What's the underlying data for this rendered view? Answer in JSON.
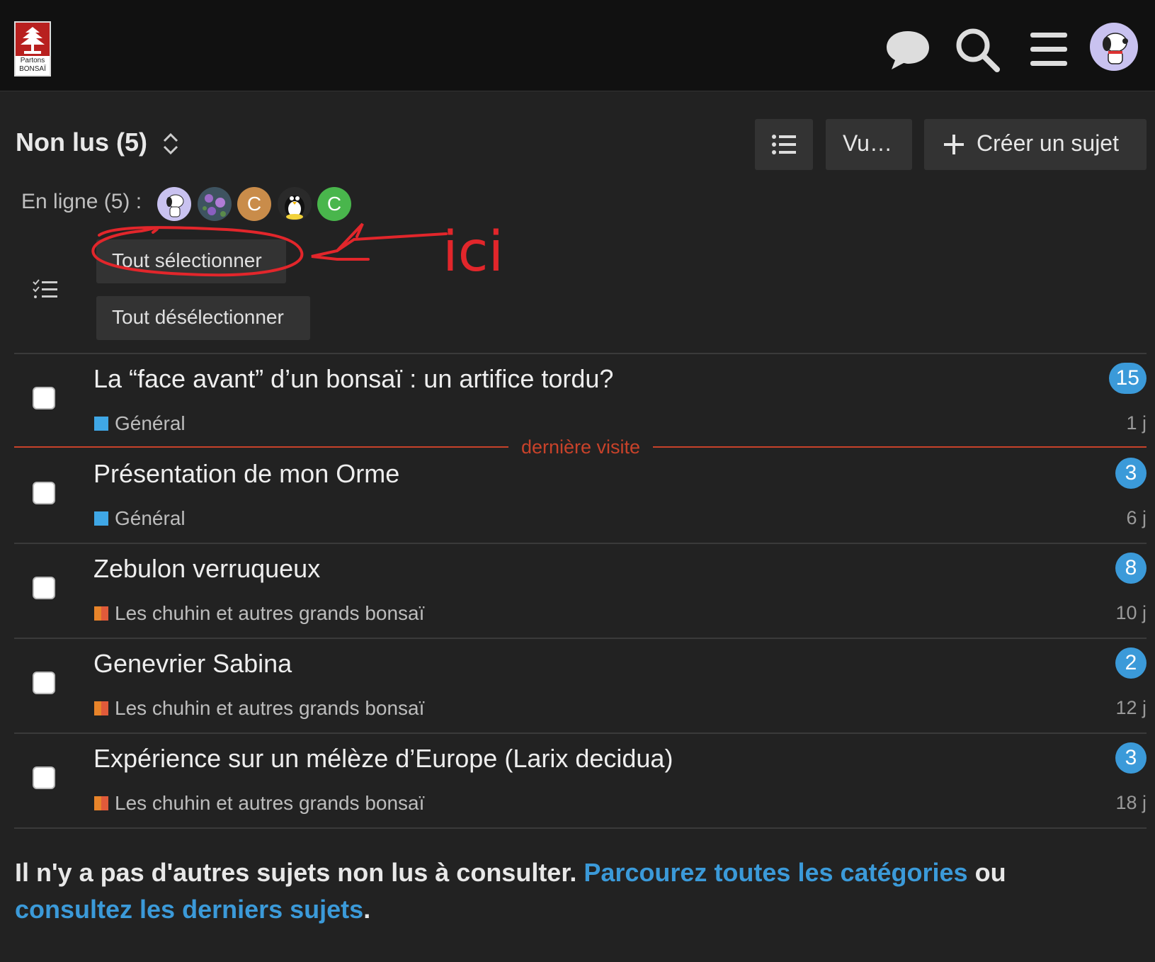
{
  "header": {
    "logo_text_line1": "Partons",
    "logo_text_line2": "BONSAÏ",
    "icons": [
      "chat-icon",
      "search-icon",
      "hamburger-menu-icon",
      "user-avatar"
    ]
  },
  "page": {
    "title": "Non lus (5)",
    "list_button_icon": "list-icon",
    "views_button_label": "Vu…",
    "create_button_label": "Créer un sujet"
  },
  "online": {
    "label": "En ligne (5) :",
    "users": [
      {
        "initial": "",
        "type": "snoopy-avatar"
      },
      {
        "initial": "",
        "type": "flowers-avatar"
      },
      {
        "initial": "C",
        "color": "#c98c4a"
      },
      {
        "initial": "",
        "type": "penguin-avatar"
      },
      {
        "initial": "C",
        "color": "#49b64c"
      }
    ]
  },
  "bulk": {
    "select_all_label": "Tout sélectionner",
    "deselect_all_label": "Tout désélectionner",
    "annotation_text": "ici"
  },
  "last_visit_label": "dernière visite",
  "topics": [
    {
      "title": "La “face avant” d’un bonsaï : un artifice tordu?",
      "category": "Général",
      "category_color": "#3fa7e6",
      "unread": "15",
      "age": "1 j"
    },
    {
      "title": "Présentation de mon Orme",
      "category": "Général",
      "category_color": "#3fa7e6",
      "unread": "3",
      "age": "6 j"
    },
    {
      "title": "Zebulon verruqueux",
      "category": "Les chuhin et autres grands bonsaï",
      "category_color": "#e8842a",
      "unread": "8",
      "age": "10 j"
    },
    {
      "title": "Genevrier Sabina",
      "category": "Les chuhin et autres grands bonsaï",
      "category_color": "#e8842a",
      "unread": "2",
      "age": "12 j"
    },
    {
      "title": "Expérience sur un mélèze d’Europe (Larix decidua)",
      "category": "Les chuhin et autres grands bonsaï",
      "category_color": "#e8842a",
      "unread": "3",
      "age": "18 j"
    }
  ],
  "footer": {
    "text_before": "Il n'y a pas d'autres sujets non lus à consulter. ",
    "link1": "Parcourez toutes les catégories",
    "text_middle": " ou ",
    "link2": "consultez les derniers sujets",
    "text_after": "."
  }
}
